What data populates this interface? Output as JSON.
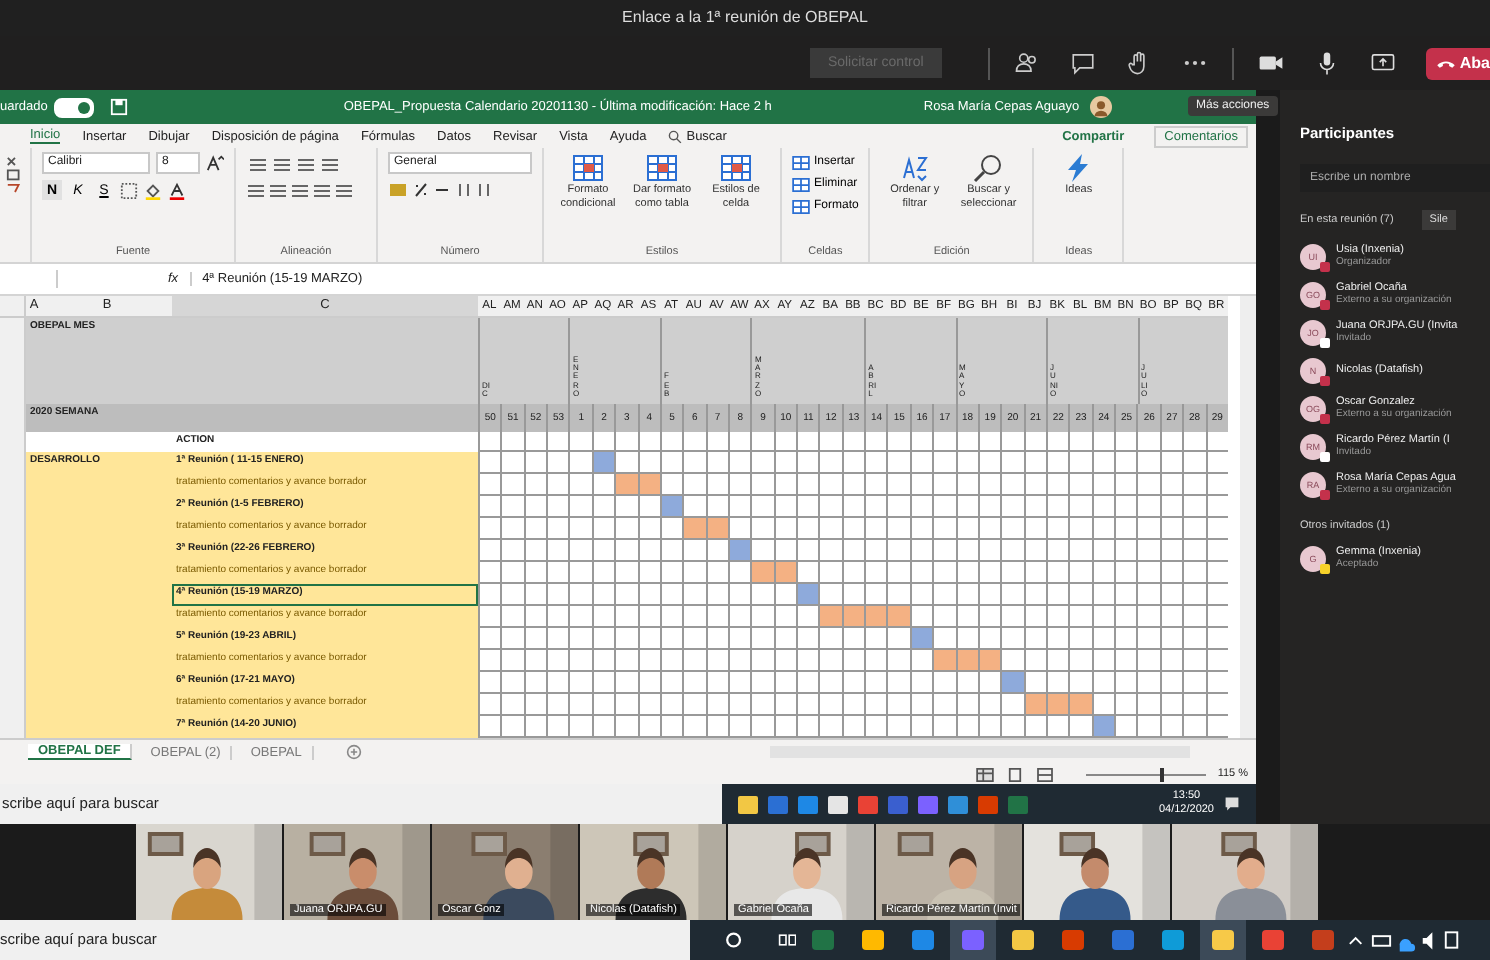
{
  "meeting": {
    "title": "Enlace a la 1ª reunión de OBEPAL",
    "control_button": "Solicitar control",
    "leave_button": "Aba",
    "tooltip": "Más acciones"
  },
  "excel": {
    "autosave": "uardado",
    "autosave_on": true,
    "title": "OBEPAL_Propuesta Calendario 20201130  -  Última modificación: Hace 2 h",
    "user": "Rosa María Cepas Aguayo",
    "tabs": [
      {
        "label": "Inicio",
        "selected": true
      },
      {
        "label": "Insertar",
        "selected": false
      },
      {
        "label": "Dibujar",
        "selected": false
      },
      {
        "label": "Disposición de página",
        "selected": false
      },
      {
        "label": "Fórmulas",
        "selected": false
      },
      {
        "label": "Datos",
        "selected": false
      },
      {
        "label": "Revisar",
        "selected": false
      },
      {
        "label": "Vista",
        "selected": false
      },
      {
        "label": "Ayuda",
        "selected": false
      }
    ],
    "search": "Buscar",
    "share": "Compartir",
    "comments": "Comentarios",
    "ribbon": {
      "font": "Calibri",
      "size": "8",
      "bold": "N",
      "italic": "K",
      "underline": "S",
      "number_format": "General",
      "groups": [
        {
          "label": "Fuente",
          "kind": "font"
        },
        {
          "label": "Alineación",
          "kind": "align"
        },
        {
          "label": "Número",
          "kind": "number"
        },
        {
          "label": "Estilos",
          "kind": "large",
          "buttons": [
            {
              "label": "Formato condicional",
              "kind": "table"
            },
            {
              "label": "Dar formato como tabla",
              "kind": "table"
            },
            {
              "label": "Estilos de celda",
              "kind": "table"
            }
          ]
        },
        {
          "label": "Celdas",
          "kind": "small",
          "buttons": [
            {
              "label": "Insertar"
            },
            {
              "label": "Eliminar"
            },
            {
              "label": "Formato"
            }
          ]
        },
        {
          "label": "Edición",
          "kind": "large",
          "buttons": [
            {
              "label": "Ordenar y filtrar",
              "kind": "sort"
            },
            {
              "label": "Buscar y seleccionar",
              "kind": "find"
            }
          ]
        },
        {
          "label": "Ideas",
          "kind": "large",
          "buttons": [
            {
              "label": "Ideas",
              "kind": "bolt"
            }
          ]
        }
      ]
    },
    "formula": {
      "function_label": "fx",
      "value": "4ª Reunión (15-19 MARZO)"
    }
  },
  "sheet": {
    "left_columns": [
      "A",
      "B",
      "C"
    ],
    "column_letters": [
      "AL",
      "AM",
      "AN",
      "AO",
      "AP",
      "AQ",
      "AR",
      "AS",
      "AT",
      "AU",
      "AV",
      "AW",
      "AX",
      "AY",
      "AZ",
      "BA",
      "BB",
      "BC",
      "BD",
      "BE",
      "BF",
      "BG",
      "BH",
      "BI",
      "BJ",
      "BK",
      "BL",
      "BM",
      "BN",
      "BO",
      "BP",
      "BQ",
      "BR"
    ],
    "month_label": "OBEPAL MES",
    "week_label": "2020 SEMANA",
    "action_label": "ACTION",
    "phase_label": "DESARROLLO",
    "months": [
      {
        "label": "DIC",
        "weeks": [
          "50",
          "51",
          "52",
          "53"
        ]
      },
      {
        "label": "ENERO",
        "weeks": [
          "1",
          "2",
          "3",
          "4"
        ]
      },
      {
        "label": "FEB",
        "weeks": [
          "5",
          "6",
          "7",
          "8"
        ]
      },
      {
        "label": "MARZO",
        "weeks": [
          "9",
          "10",
          "11",
          "12",
          "13"
        ]
      },
      {
        "label": "ABRIL",
        "weeks": [
          "14",
          "15",
          "16",
          "17"
        ]
      },
      {
        "label": "MAYO",
        "weeks": [
          "18",
          "19",
          "20",
          "21"
        ]
      },
      {
        "label": "JUNIO",
        "weeks": [
          "22",
          "23",
          "24",
          "25"
        ]
      },
      {
        "label": "JULIO",
        "weeks": [
          "26",
          "27",
          "28",
          "29"
        ]
      }
    ],
    "rows": [
      {
        "kind": "meeting",
        "label": "1ª Reunión ( 11-15 ENERO)",
        "selected": false,
        "cells": [
          false,
          false,
          false,
          false,
          false,
          true,
          false,
          false,
          false,
          false,
          false,
          false,
          false,
          false,
          false,
          false,
          false,
          false,
          false,
          false,
          false,
          false,
          false,
          false,
          false,
          false,
          false,
          false,
          false,
          false,
          false,
          false,
          false
        ]
      },
      {
        "kind": "task",
        "label": "tratamiento comentarios y avance borrador",
        "selected": false,
        "cells": [
          false,
          false,
          false,
          false,
          false,
          false,
          true,
          true,
          false,
          false,
          false,
          false,
          false,
          false,
          false,
          false,
          false,
          false,
          false,
          false,
          false,
          false,
          false,
          false,
          false,
          false,
          false,
          false,
          false,
          false,
          false,
          false,
          false
        ]
      },
      {
        "kind": "meeting",
        "label": "2ª Reunión (1-5 FEBRERO)",
        "selected": false,
        "cells": [
          false,
          false,
          false,
          false,
          false,
          false,
          false,
          false,
          true,
          false,
          false,
          false,
          false,
          false,
          false,
          false,
          false,
          false,
          false,
          false,
          false,
          false,
          false,
          false,
          false,
          false,
          false,
          false,
          false,
          false,
          false,
          false,
          false
        ]
      },
      {
        "kind": "task",
        "label": "tratamiento comentarios y avance borrador",
        "selected": false,
        "cells": [
          false,
          false,
          false,
          false,
          false,
          false,
          false,
          false,
          false,
          true,
          true,
          false,
          false,
          false,
          false,
          false,
          false,
          false,
          false,
          false,
          false,
          false,
          false,
          false,
          false,
          false,
          false,
          false,
          false,
          false,
          false,
          false,
          false
        ]
      },
      {
        "kind": "meeting",
        "label": "3ª Reunión (22-26 FEBRERO)",
        "selected": false,
        "cells": [
          false,
          false,
          false,
          false,
          false,
          false,
          false,
          false,
          false,
          false,
          false,
          true,
          false,
          false,
          false,
          false,
          false,
          false,
          false,
          false,
          false,
          false,
          false,
          false,
          false,
          false,
          false,
          false,
          false,
          false,
          false,
          false,
          false
        ]
      },
      {
        "kind": "task",
        "label": "tratamiento comentarios y avance borrador",
        "selected": false,
        "cells": [
          false,
          false,
          false,
          false,
          false,
          false,
          false,
          false,
          false,
          false,
          false,
          false,
          true,
          true,
          false,
          false,
          false,
          false,
          false,
          false,
          false,
          false,
          false,
          false,
          false,
          false,
          false,
          false,
          false,
          false,
          false,
          false,
          false
        ]
      },
      {
        "kind": "meeting",
        "label": "4ª Reunión (15-19 MARZO)",
        "selected": true,
        "cells": [
          false,
          false,
          false,
          false,
          false,
          false,
          false,
          false,
          false,
          false,
          false,
          false,
          false,
          false,
          true,
          false,
          false,
          false,
          false,
          false,
          false,
          false,
          false,
          false,
          false,
          false,
          false,
          false,
          false,
          false,
          false,
          false,
          false
        ]
      },
      {
        "kind": "task",
        "label": "tratamiento comentarios y avance borrador",
        "selected": false,
        "cells": [
          false,
          false,
          false,
          false,
          false,
          false,
          false,
          false,
          false,
          false,
          false,
          false,
          false,
          false,
          false,
          true,
          true,
          true,
          true,
          false,
          false,
          false,
          false,
          false,
          false,
          false,
          false,
          false,
          false,
          false,
          false,
          false,
          false
        ]
      },
      {
        "kind": "meeting",
        "label": "5ª Reunión (19-23 ABRIL)",
        "selected": false,
        "cells": [
          false,
          false,
          false,
          false,
          false,
          false,
          false,
          false,
          false,
          false,
          false,
          false,
          false,
          false,
          false,
          false,
          false,
          false,
          false,
          true,
          false,
          false,
          false,
          false,
          false,
          false,
          false,
          false,
          false,
          false,
          false,
          false,
          false
        ]
      },
      {
        "kind": "task",
        "label": "tratamiento comentarios y avance borrador",
        "selected": false,
        "cells": [
          false,
          false,
          false,
          false,
          false,
          false,
          false,
          false,
          false,
          false,
          false,
          false,
          false,
          false,
          false,
          false,
          false,
          false,
          false,
          false,
          true,
          true,
          true,
          false,
          false,
          false,
          false,
          false,
          false,
          false,
          false,
          false,
          false
        ]
      },
      {
        "kind": "meeting",
        "label": "6ª Reunión (17-21 MAYO)",
        "selected": false,
        "cells": [
          false,
          false,
          false,
          false,
          false,
          false,
          false,
          false,
          false,
          false,
          false,
          false,
          false,
          false,
          false,
          false,
          false,
          false,
          false,
          false,
          false,
          false,
          false,
          true,
          false,
          false,
          false,
          false,
          false,
          false,
          false,
          false,
          false
        ]
      },
      {
        "kind": "task",
        "label": "tratamiento comentarios y avance borrador",
        "selected": false,
        "cells": [
          false,
          false,
          false,
          false,
          false,
          false,
          false,
          false,
          false,
          false,
          false,
          false,
          false,
          false,
          false,
          false,
          false,
          false,
          false,
          false,
          false,
          false,
          false,
          false,
          true,
          true,
          true,
          false,
          false,
          false,
          false,
          false,
          false
        ]
      },
      {
        "kind": "meeting",
        "label": "7ª Reunión (14-20 JUNIO)",
        "selected": false,
        "cells": [
          false,
          false,
          false,
          false,
          false,
          false,
          false,
          false,
          false,
          false,
          false,
          false,
          false,
          false,
          false,
          false,
          false,
          false,
          false,
          false,
          false,
          false,
          false,
          false,
          false,
          false,
          false,
          true,
          false,
          false,
          false,
          false,
          false
        ]
      }
    ],
    "sheet_tabs": [
      {
        "label": "OBEPAL DEF",
        "selected": true
      },
      {
        "label": "OBEPAL (2)",
        "selected": false
      },
      {
        "label": "OBEPAL",
        "selected": false
      }
    ],
    "zoom": "115 %",
    "zoom_slider": {
      "level": 0.62
    }
  },
  "shared_taskbar": {
    "search": "scribe aquí para buscar",
    "time": "13:50",
    "date": "04/12/2020"
  },
  "participants": {
    "title": "Participantes",
    "search_placeholder": "Escribe un nombre",
    "in_meeting": "En esta reunión (7)",
    "mute_button": "Sile",
    "people": [
      {
        "initials": "UI",
        "name": "Usia (Inxenia)",
        "role": "Organizador",
        "color": "#c4314b"
      },
      {
        "initials": "GO",
        "name": "Gabriel Ocaña",
        "role": "Externo a su organización",
        "color": "#c4314b"
      },
      {
        "initials": "JO",
        "name": "Juana ORJPA.GU (Invita",
        "role": "Invitado",
        "color": "#ffffff"
      },
      {
        "initials": "N",
        "name": "Nicolas (Datafish)",
        "color": "#c4314b"
      },
      {
        "initials": "OG",
        "name": "Oscar Gonzalez",
        "role": "Externo a su organización",
        "color": "#c4314b"
      },
      {
        "initials": "RM",
        "name": "Ricardo Pérez Martín (I",
        "role": "Invitado",
        "color": "#ffffff"
      },
      {
        "initials": "RA",
        "name": "Rosa María Cepas Agua",
        "role": "Externo a su organización",
        "color": "#c4314b"
      }
    ],
    "others": "Otros invitados (1)",
    "invited": [
      {
        "initials": "G",
        "name": "Gemma (Inxenia)",
        "role": "Aceptado",
        "color": "#f8d22a"
      }
    ]
  },
  "video_tiles": [
    {
      "kind": "picture"
    },
    {
      "kind": "picture",
      "name": "Juana ORJPA.GU"
    },
    {
      "kind": "picture",
      "name": "Oscar Gonz"
    },
    {
      "kind": "picture",
      "name": "Nicolas (Datafish)"
    },
    {
      "kind": "picture",
      "name": "Gabriel Ocaña"
    },
    {
      "kind": "picture",
      "name": "Ricardo Pérez Martín (Invit"
    },
    {
      "kind": "picture"
    },
    {
      "kind": "picture"
    }
  ],
  "taskbar": {
    "search": "scribe aquí para buscar"
  }
}
